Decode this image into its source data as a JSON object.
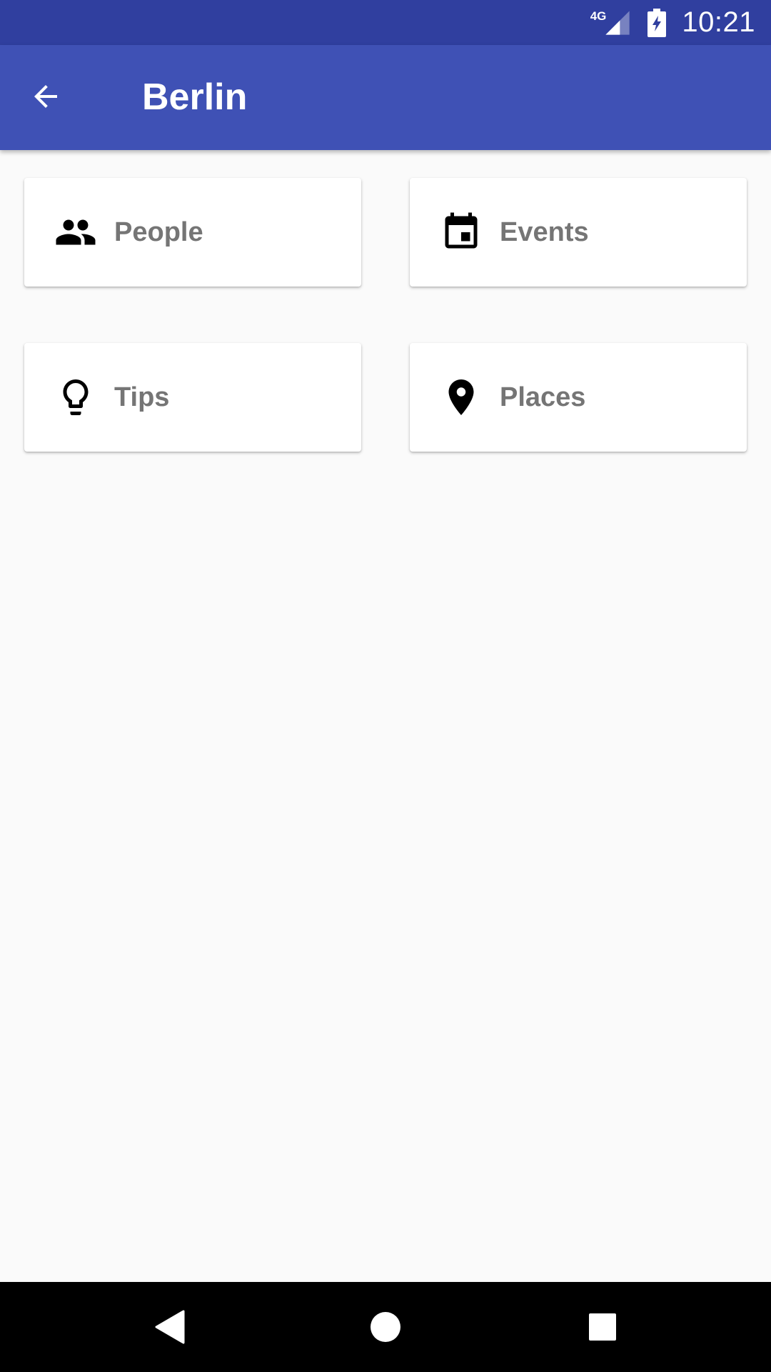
{
  "status_bar": {
    "network_type": "4G",
    "time": "10:21",
    "signal_icon": "signal-icon",
    "battery_icon": "battery-charging-icon"
  },
  "app_bar": {
    "title": "Berlin",
    "back_icon": "arrow-back-icon",
    "background_color": "#3f51b5",
    "status_color": "#303f9f"
  },
  "cards": [
    {
      "label": "People",
      "icon": "people-icon"
    },
    {
      "label": "Events",
      "icon": "calendar-event-icon"
    },
    {
      "label": "Tips",
      "icon": "lightbulb-icon"
    },
    {
      "label": "Places",
      "icon": "place-pin-icon"
    }
  ],
  "nav_bar": {
    "back_icon": "nav-back-icon",
    "home_icon": "nav-home-icon",
    "recents_icon": "nav-recents-icon"
  }
}
